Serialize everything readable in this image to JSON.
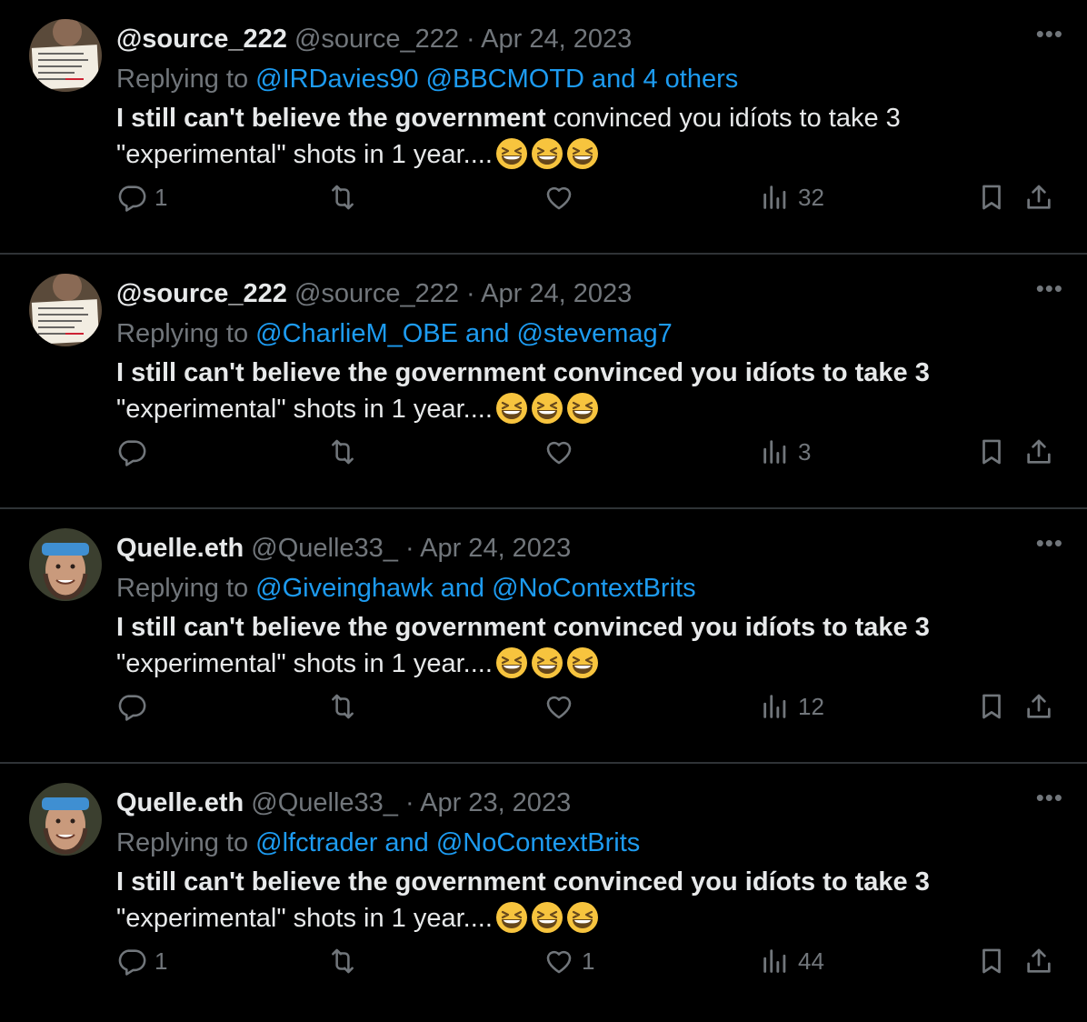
{
  "tweets": [
    {
      "name": "@source_222",
      "handle": "@source_222",
      "separator": "·",
      "date": "Apr 24, 2023",
      "reply_prefix": "Replying to",
      "reply_mentions": "@IRDavies90 @BBCMOTD and 4 others",
      "body_bold": "I still can't believe the government",
      "body_rest": " convinced you idíots to take 3 \"experimental\" shots in 1 year....",
      "emoji_count": 3,
      "replies": "1",
      "retweets": "",
      "likes": "",
      "views": "32",
      "avatar": "sign"
    },
    {
      "name": "@source_222",
      "handle": "@source_222",
      "separator": "·",
      "date": "Apr 24, 2023",
      "reply_prefix": "Replying to",
      "reply_mentions": "@CharlieM_OBE and @stevemag7",
      "body_bold": "I still can't believe the government convinced you idíots to take 3",
      "body_rest": " \"experimental\" shots in 1 year....",
      "emoji_count": 3,
      "replies": "",
      "retweets": "",
      "likes": "",
      "views": "3",
      "avatar": "sign"
    },
    {
      "name": "Quelle.eth",
      "handle": "@Quelle33_",
      "separator": "·",
      "date": "Apr 24, 2023",
      "reply_prefix": "Replying to",
      "reply_mentions": "@Giveinghawk and @NoContextBrits",
      "body_bold": "I still can't believe the government convinced you idíots to take 3",
      "body_rest": " \"experimental\" shots in 1 year....",
      "emoji_count": 3,
      "replies": "",
      "retweets": "",
      "likes": "",
      "views": "12",
      "avatar": "face"
    },
    {
      "name": "Quelle.eth",
      "handle": "@Quelle33_",
      "separator": "·",
      "date": "Apr 23, 2023",
      "reply_prefix": "Replying to",
      "reply_mentions": "@lfctrader and @NoContextBrits",
      "body_bold": "I still can't believe the government convinced you idíots to take 3",
      "body_rest": " \"experimental\" shots in 1 year....",
      "emoji_count": 3,
      "replies": "1",
      "retweets": "",
      "likes": "1",
      "views": "44",
      "avatar": "face"
    }
  ],
  "icons": {
    "reply": "reply-icon",
    "retweet": "retweet-icon",
    "like": "like-icon",
    "views": "views-icon",
    "bookmark": "bookmark-icon",
    "share": "share-icon",
    "more": "more-icon",
    "emoji": "grinning-squinting-face-emoji"
  },
  "colors": {
    "background": "#000000",
    "text": "#e7e9ea",
    "muted": "#71767b",
    "link": "#1d9bf0",
    "divider": "#2f3336"
  }
}
